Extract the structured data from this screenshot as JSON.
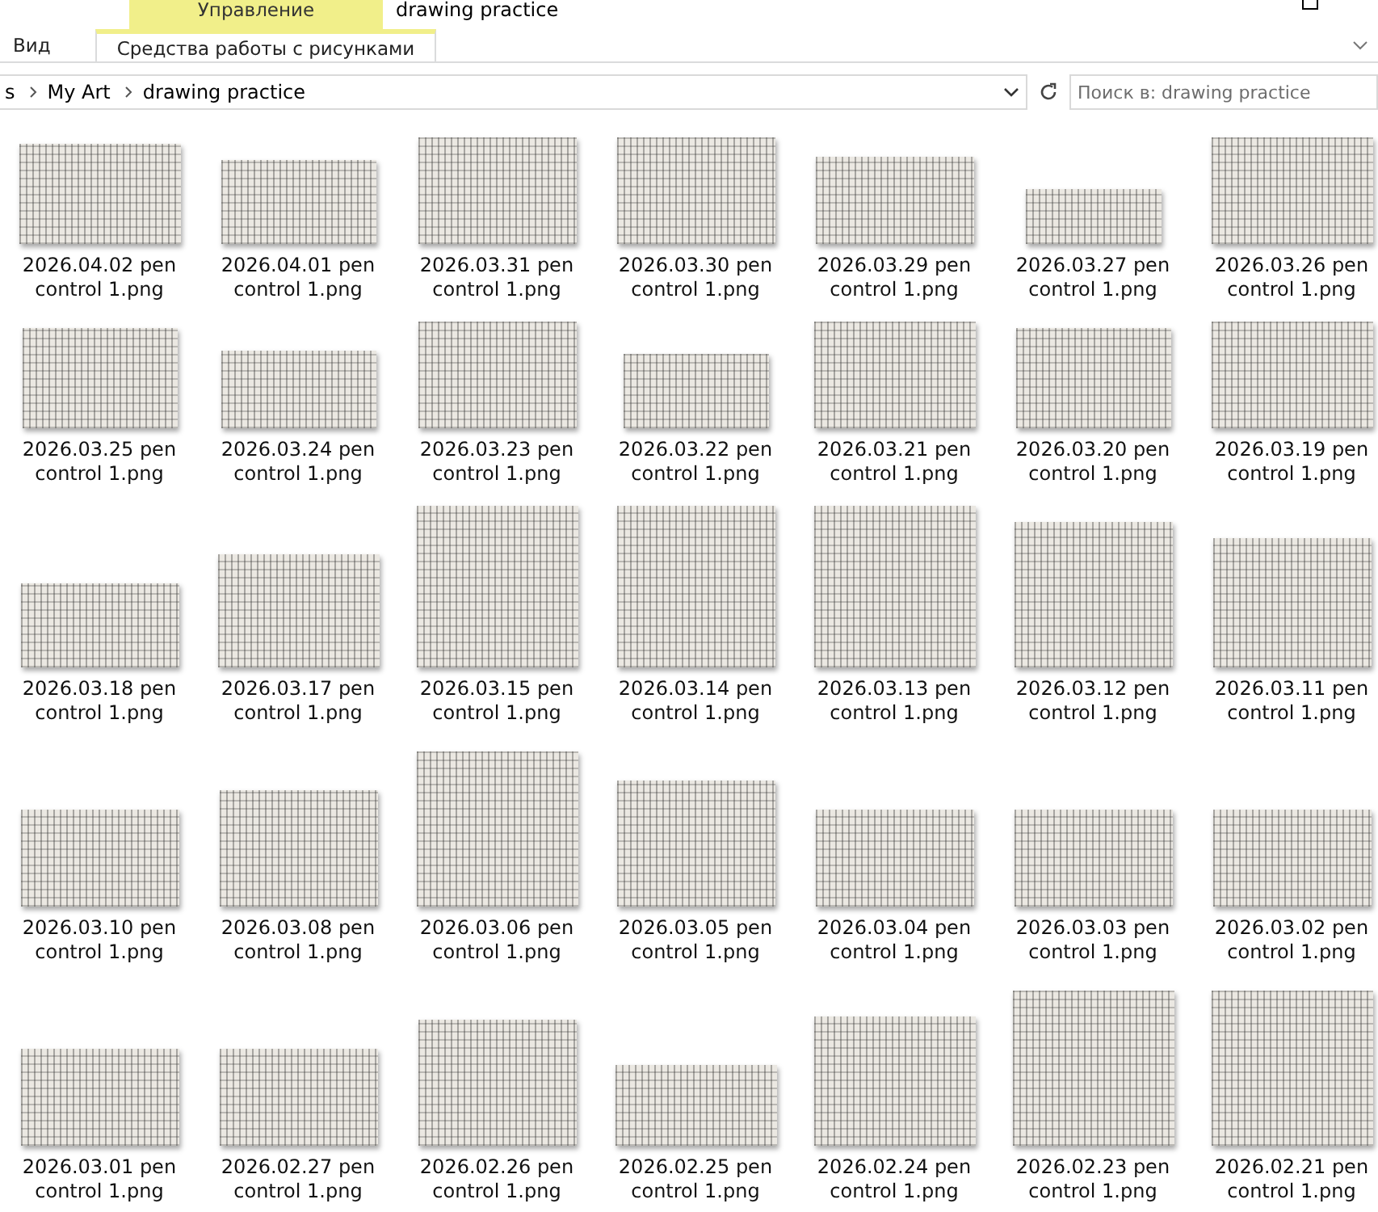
{
  "window": {
    "title": "drawing practice",
    "context_tab": "Управление"
  },
  "ribbon_tabs": [
    {
      "label": "Вид",
      "selected": false
    },
    {
      "label": "Средства работы с рисунками",
      "selected": true
    }
  ],
  "address_bar": {
    "crumbs": [
      "s",
      "My Art",
      "drawing practice"
    ]
  },
  "search": {
    "placeholder": "Поиск в: drawing practice"
  },
  "files": [
    {
      "name": "2026.04.02 pen control 1.png"
    },
    {
      "name": "2026.04.01 pen control 1.png"
    },
    {
      "name": "2026.03.31 pen control 1.png"
    },
    {
      "name": "2026.03.30 pen control 1.png"
    },
    {
      "name": "2026.03.29 pen control 1.png"
    },
    {
      "name": "2026.03.27 pen control 1.png"
    },
    {
      "name": "2026.03.26 pen control 1.png"
    },
    {
      "name": "2026.03.25 pen control 1.png"
    },
    {
      "name": "2026.03.24 pen control 1.png"
    },
    {
      "name": "2026.03.23 pen control 1.png"
    },
    {
      "name": "2026.03.22 pen control 1.png"
    },
    {
      "name": "2026.03.21 pen control 1.png"
    },
    {
      "name": "2026.03.20 pen control 1.png"
    },
    {
      "name": "2026.03.19 pen control 1.png"
    },
    {
      "name": "2026.03.18 pen control 1.png"
    },
    {
      "name": "2026.03.17 pen control 1.png"
    },
    {
      "name": "2026.03.15 pen control 1.png"
    },
    {
      "name": "2026.03.14 pen control 1.png"
    },
    {
      "name": "2026.03.13 pen control 1.png"
    },
    {
      "name": "2026.03.12 pen control 1.png"
    },
    {
      "name": "2026.03.11 pen control 1.png"
    },
    {
      "name": "2026.03.10 pen control 1.png"
    },
    {
      "name": "2026.03.08 pen control 1.png"
    },
    {
      "name": "2026.03.06 pen control 1.png"
    },
    {
      "name": "2026.03.05 pen control 1.png"
    },
    {
      "name": "2026.03.04 pen control 1.png"
    },
    {
      "name": "2026.03.03 pen control 1.png"
    },
    {
      "name": "2026.03.02 pen control 1.png"
    },
    {
      "name": "2026.03.01 pen control 1.png"
    },
    {
      "name": "2026.02.27 pen control 1.png"
    },
    {
      "name": "2026.02.26 pen control 1.png"
    },
    {
      "name": "2026.02.25 pen control 1.png"
    },
    {
      "name": "2026.02.24 pen control 1.png"
    },
    {
      "name": "2026.02.23 pen control 1.png"
    },
    {
      "name": "2026.02.21 pen control 1.png"
    }
  ]
}
